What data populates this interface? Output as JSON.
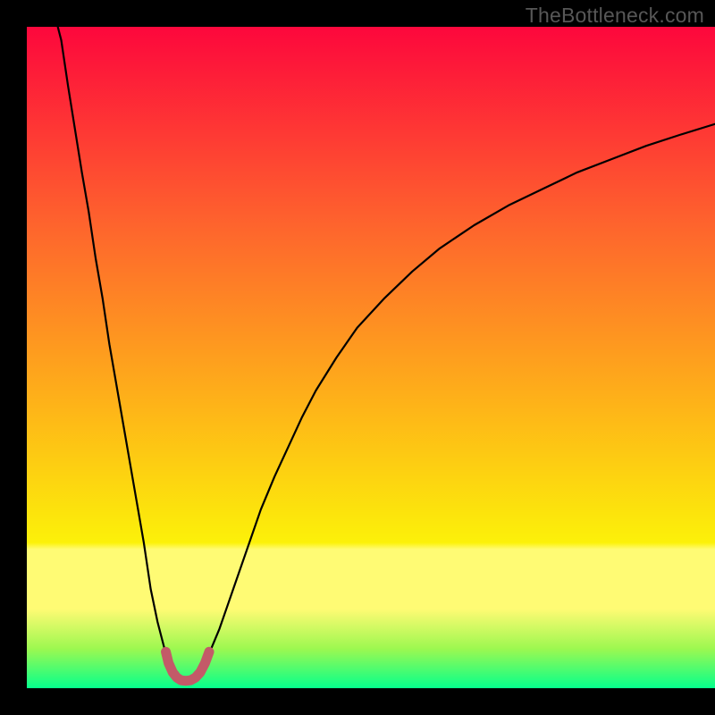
{
  "watermark": {
    "text": "TheBottleneck.com"
  },
  "chart_data": {
    "type": "line",
    "title": "",
    "xlabel": "",
    "ylabel": "",
    "xlim": [
      0,
      100
    ],
    "ylim": [
      0,
      100
    ],
    "grid": false,
    "legend": false,
    "series": [
      {
        "name": "left-arm",
        "x": [
          4.5,
          5,
          6,
          7,
          8,
          9,
          10,
          11,
          12,
          13,
          14,
          15,
          16,
          17,
          18,
          19,
          20,
          21,
          21.5
        ],
        "values": [
          100,
          98,
          91,
          84.5,
          78,
          72,
          65,
          59,
          52,
          46,
          40,
          34,
          28,
          22,
          15,
          10,
          6,
          3,
          2
        ]
      },
      {
        "name": "right-arm",
        "x": [
          24.8,
          26,
          28,
          30,
          32,
          34,
          36,
          38,
          40,
          42,
          45,
          48,
          52,
          56,
          60,
          65,
          70,
          75,
          80,
          85,
          90,
          95,
          100
        ],
        "values": [
          2,
          4,
          9,
          15,
          21,
          27,
          32,
          36.5,
          41,
          45,
          50,
          54.5,
          59,
          63,
          66.5,
          70,
          73,
          75.5,
          78,
          80,
          82,
          83.7,
          85.3
        ]
      },
      {
        "name": "red-bottom-u",
        "x": [
          20.2,
          20.6,
          21.2,
          21.8,
          22.4,
          23.1,
          23.8,
          24.5,
          25.2,
          25.9,
          26.5
        ],
        "values": [
          5.5,
          3.8,
          2.4,
          1.6,
          1.2,
          1.1,
          1.2,
          1.6,
          2.4,
          3.8,
          5.5
        ]
      }
    ],
    "colors": {
      "curve_main": "#000000",
      "curve_u": "#c35a68",
      "gradient_top": "#fd073c",
      "gradient_mid_red_orange": "#fe642d",
      "gradient_mid_orange": "#fead1a",
      "gradient_mid_yellow": "#fcf109",
      "gradient_greenish": "#9df850",
      "gradient_green": "#05ff8c"
    },
    "annotations": []
  }
}
